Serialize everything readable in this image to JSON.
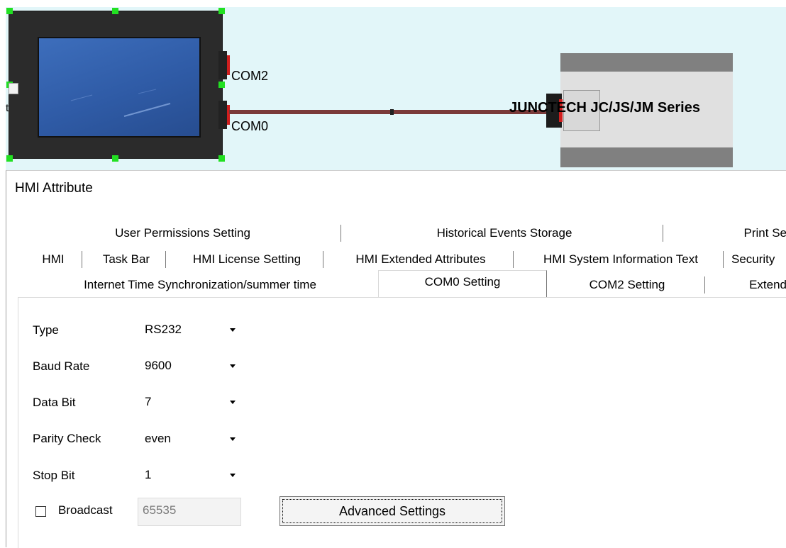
{
  "canvas": {
    "hmi_left_label": "t",
    "ports": [
      "COM2",
      "COM0"
    ],
    "plc_name": "JUNCTECH JC/JS/JM Series"
  },
  "dialog": {
    "title": "HMI Attribute",
    "tab_rows": [
      [
        "User Permissions Setting",
        "Historical Events Storage",
        "Print Se"
      ],
      [
        "HMI",
        "Task Bar",
        "HMI License Setting",
        "HMI Extended Attributes",
        "HMI System Information Text",
        "Security"
      ],
      [
        "Internet Time Synchronization/summer time",
        "COM0 Setting",
        "COM2 Setting",
        "Extend"
      ]
    ],
    "active_tab": "COM0 Setting"
  },
  "com0_setting": {
    "fields": [
      {
        "label": "Type",
        "value": "RS232"
      },
      {
        "label": "Baud Rate",
        "value": "9600"
      },
      {
        "label": "Data Bit",
        "value": "7"
      },
      {
        "label": "Parity Check",
        "value": "even"
      },
      {
        "label": "Stop Bit",
        "value": "1"
      }
    ],
    "broadcast": {
      "label": "Broadcast",
      "checked": false,
      "value": "65535"
    },
    "advanced_button": "Advanced Settings"
  },
  "colors": {
    "canvas_bg": "#e2f6f9",
    "selection_handle": "#22e022",
    "cable": "#7a3a3a",
    "port_accent": "#d01e1e",
    "hmi_screen": "#2f5ba6"
  }
}
